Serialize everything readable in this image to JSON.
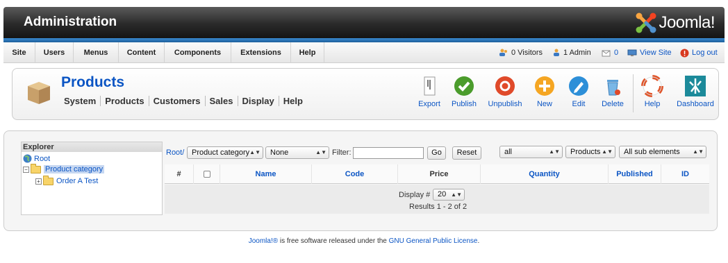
{
  "header": {
    "title": "Administration",
    "logo_text": "Joomla!"
  },
  "menu": [
    "Site",
    "Users",
    "Menus",
    "Content",
    "Components",
    "Extensions",
    "Help"
  ],
  "status": {
    "visitors": "0 Visitors",
    "admins": "1 Admin",
    "messages": "0",
    "view_site": "View Site",
    "logout": "Log out"
  },
  "toolbar": {
    "title": "Products",
    "submenu": [
      "System",
      "Products",
      "Customers",
      "Sales",
      "Display",
      "Help"
    ],
    "buttons": {
      "export": "Export",
      "publish": "Publish",
      "unpublish": "Unpublish",
      "new": "New",
      "edit": "Edit",
      "delete": "Delete",
      "help": "Help",
      "dashboard": "Dashboard"
    }
  },
  "explorer": {
    "title": "Explorer",
    "root": "Root",
    "category": "Product category",
    "child": "Order A Test"
  },
  "filters": {
    "breadcrumb": "Root/",
    "category_select": "Product category",
    "none_select": "None",
    "filter_label": "Filter:",
    "filter_value": "",
    "go": "Go",
    "reset": "Reset",
    "all_select": "all",
    "products_select": "Products",
    "sub_select": "All sub elements"
  },
  "table": {
    "columns": {
      "num": "#",
      "name": "Name",
      "code": "Code",
      "price": "Price",
      "quantity": "Quantity",
      "published": "Published",
      "id": "ID"
    },
    "display_label": "Display #",
    "display_value": "20",
    "results": "Results 1 - 2 of 2"
  },
  "footer": {
    "joomla_link": "Joomla!®",
    "text": " is free software released under the ",
    "license_link": "GNU General Public License",
    "end": "."
  }
}
